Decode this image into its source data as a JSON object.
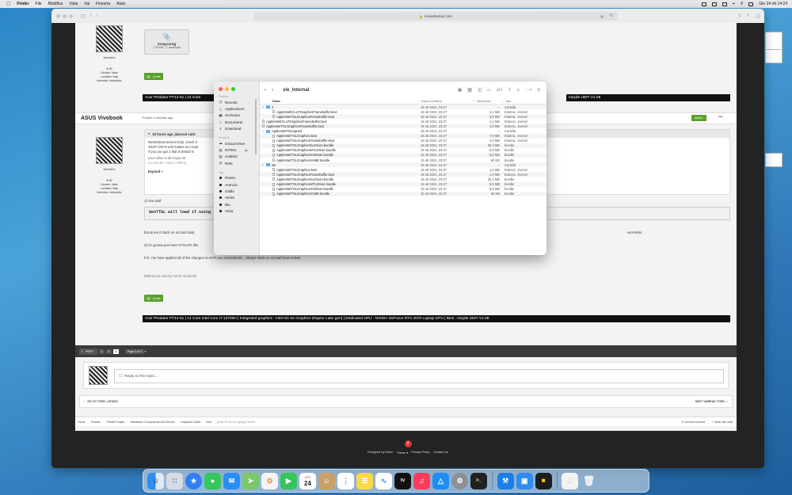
{
  "menubar": {
    "app": "Finder",
    "items": [
      "File",
      "Modifica",
      "Vista",
      "Vai",
      "Finestra",
      "Aiuto"
    ],
    "clock": "Gio 24 ott 14:24"
  },
  "desktop": {
    "icons": [
      "",
      "",
      ""
    ]
  },
  "browser": {
    "url": "insanelymac.com",
    "attachment": {
      "name": "ioreg.ioreg",
      "meta": "7.35 MB · 1 download"
    },
    "signature": "Acer Predator PT14-51 | 14 Core Intel Core i7-13700H | Integrated graphics : Intel Iris Xe Graphics (Raptor Lake gen) | Dedicated GPU : NVIDIA GeForce RTX 4070 Laptop GPU | Bios : Insyde UEFI V1.08",
    "sig_top_left": "Acer Predator PT14-51 | 14 Core",
    "sig_top_right": "Insyde UEFI V1.08",
    "user": {
      "likes": "69",
      "gender": "Gender: Male",
      "location": "Location: Italy",
      "interests": "Interests: informatic",
      "role": "Members"
    },
    "post": {
      "author": "ASUS Vivobook",
      "posted": "Posted 3 minutes ago",
      "badge": "Author",
      "quote_header": "15 hours ago, jalavoul said:",
      "quote_lines": [
        "RestrictEvents.kext help. check S",
        "SSDT-OSYS.aml makes os x load",
        "if you can get 1 that is tested fo",
        "your nblue is all empty lol",
        "no wonder it does nothing"
      ],
      "expand": "Expand",
      "p1": "1) You said",
      "code": "Gen7TGL will load if using",
      "p2": "but at me it stuck on os boot load.",
      "p2_right": "surrender.",
      "p3": "2) I'm gonna put more SYSLOG like",
      "p4": "P.S. I've have applied all of the changes to ACPI you recommend .. always stuck on os load boot screen",
      "edited": "Edited just now by ASUS Vivobook",
      "quote_btn": "Quote"
    },
    "pagination": {
      "prev": "PREV",
      "pages": [
        "1",
        "2",
        "3"
      ],
      "current": "3",
      "label": "Page 3 of 3"
    },
    "reply_placeholder": "Reply to this topic...",
    "topic_nav": {
      "left": "GO TO TOPIC LISTING",
      "right": "NEXT UNREAD TOPIC"
    },
    "breadcrumbs": [
      "Home",
      "Forums",
      "OSx86 Project",
      "Hardware Components and Drivers",
      "Graphics Cards",
      "Intel",
      "[Acer PT14-51 Laptop] HowTo"
    ],
    "crumb_actions": [
      "Unread Content",
      "Mark site read"
    ],
    "footer": {
      "designed": "Designed by Ehren",
      "links": [
        "Theme",
        "Privacy Policy",
        "Contact Us"
      ]
    }
  },
  "finder": {
    "title": "sle_Internal",
    "sidebar": {
      "favorites_header": "Preferiti",
      "favorites": [
        "Recenti",
        "Applicazioni",
        "Scrivania",
        "Documenti",
        "Download"
      ],
      "locations_header": "Posizioni",
      "locations": [
        "iCloud Drive",
        "INTEN...",
        "Untitled",
        "Rete"
      ],
      "tags_header": "Tag",
      "tags": [
        "Rosso",
        "Arancio",
        "Giallo",
        "Verde",
        "Blu",
        "Viola"
      ]
    },
    "columns": {
      "name": "Nome",
      "date": "Data di modifica",
      "size": "Dimensioni",
      "kind": "Tipo"
    },
    "rows": [
      {
        "name": "2",
        "date": "19 ott 2024, 23:27",
        "size": "--",
        "kind": "Cartella",
        "folder": true,
        "level": 0
      },
      {
        "name": "AppleIntelICLLPGraphicsFramebuffer.kext",
        "date": "19 ott 2024, 23:27",
        "size": "4,4 MB",
        "kind": "Estensi...Kernel",
        "folder": false,
        "level": 1
      },
      {
        "name": "AppleIntelTGLGraphicsFramebuffer.kext",
        "date": "19 ott 2024, 23:27",
        "size": "3,9 MB",
        "kind": "Estensi...Kernel",
        "folder": false,
        "level": 1
      },
      {
        "name": "AppleIntelICLLPGraphicsFramebuffer.kext",
        "date": "19 ott 2024, 23:27",
        "size": "4,4 MB",
        "kind": "Estensi...Kernel",
        "folder": false,
        "level": 0
      },
      {
        "name": "AppleIntelTGLGraphicsFramebuffer.kext",
        "date": "19 ott 2024, 23:27",
        "size": "3,9 MB",
        "kind": "Estensi...Kernel",
        "folder": false,
        "level": 0
      },
      {
        "name": "AppleIntelTGLsigned",
        "date": "19 ott 2024, 23:27",
        "size": "--",
        "kind": "Cartella",
        "folder": true,
        "level": 0
      },
      {
        "name": "AppleIntelTGLGraphics.kext",
        "date": "19 ott 2024, 23:27",
        "size": "7,9 MB",
        "kind": "Estensi...Kernel",
        "folder": false,
        "level": 1
      },
      {
        "name": "AppleIntelTGLGraphicsFramebuffer.kext",
        "date": "19 ott 2024, 23:27",
        "size": "2,9 MB",
        "kind": "Estensi...Kernel",
        "folder": false,
        "level": 1
      },
      {
        "name": "AppleIntelTGLGraphicsGLDriver.bundle",
        "date": "19 ott 2024, 23:27",
        "size": "25,4 MB",
        "kind": "bundle",
        "folder": false,
        "level": 1
      },
      {
        "name": "AppleIntelTGLGraphicsMTLDriver.bundle",
        "date": "19 ott 2024, 23:27",
        "size": "8,9 MB",
        "kind": "bundle",
        "folder": false,
        "level": 1
      },
      {
        "name": "AppleIntelTGLGraphicsVADriver.bundle",
        "date": "19 ott 2024, 23:27",
        "size": "8,5 MB",
        "kind": "bundle",
        "folder": false,
        "level": 1
      },
      {
        "name": "AppleIntelTGLGraphicsVAME.bundle",
        "date": "19 ott 2024, 23:27",
        "size": "60 KB",
        "kind": "bundle",
        "folder": false,
        "level": 1
      },
      {
        "name": "sle",
        "date": "19 ott 2024, 23:27",
        "size": "--",
        "kind": "Cartella",
        "folder": true,
        "level": 0
      },
      {
        "name": "AppleIntelTGLGraphics.kext",
        "date": "19 ott 2024, 23:27",
        "size": "1,6 MB",
        "kind": "Estensi...Kernel",
        "folder": false,
        "level": 1
      },
      {
        "name": "AppleIntelTGLGraphicsFramebuffer.kext",
        "date": "19 ott 2024, 23:27",
        "size": "2,9 MB",
        "kind": "Estensi...Kernel",
        "folder": false,
        "level": 1
      },
      {
        "name": "AppleIntelTGLGraphicsGLDriver.bundle",
        "date": "19 ott 2024, 23:27",
        "size": "25,4 MB",
        "kind": "bundle",
        "folder": false,
        "level": 1
      },
      {
        "name": "AppleIntelTGLGraphicsMTLDriver.bundle",
        "date": "19 ott 2024, 23:27",
        "size": "8,9 MB",
        "kind": "bundle",
        "folder": false,
        "level": 1
      },
      {
        "name": "AppleIntelTGLGraphicsVADriver.bundle",
        "date": "19 ott 2024, 23:27",
        "size": "8,5 MB",
        "kind": "bundle",
        "folder": false,
        "level": 1
      },
      {
        "name": "AppleIntelTGLGraphicsVAME.bundle",
        "date": "19 ott 2024, 23:27",
        "size": "60 KB",
        "kind": "bundle",
        "folder": false,
        "level": 1
      }
    ]
  },
  "dock": {
    "calendar_month": "OTT",
    "calendar_day": "24",
    "tv": "tv",
    "icons": [
      "finder-icon",
      "launchpad-icon",
      "safari-icon",
      "messages-icon",
      "mail-icon",
      "maps-icon",
      "photos-icon",
      "facetime-icon",
      "calendar-icon",
      "contacts-icon",
      "reminders-icon",
      "notes-icon",
      "freeform-icon",
      "tv-icon",
      "music-icon",
      "app-store-icon",
      "system-settings-icon",
      "terminal-icon",
      "xcode-icon",
      "preview-icon",
      "hardware-monitor-icon",
      "document-icon",
      "trash-icon"
    ]
  },
  "colors": {
    "accent_green": "#5aa02c",
    "finder_folder": "#5aaee8",
    "footer_bg": "#232323"
  }
}
